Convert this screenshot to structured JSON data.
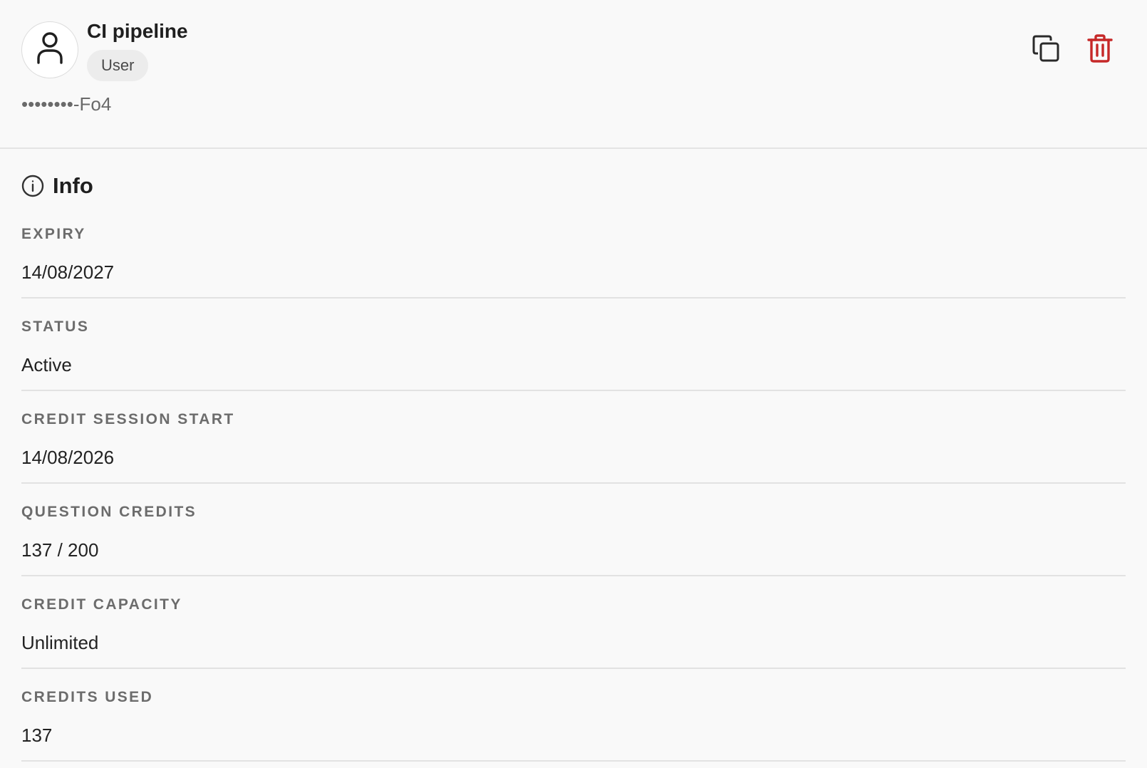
{
  "key": {
    "name": "CI pipeline",
    "role": "User",
    "masked_value": "••••••••-Fo4"
  },
  "actions": {
    "copy_icon": "copy-icon",
    "delete_icon": "trash-icon",
    "delete_color": "#c62828"
  },
  "info": {
    "title": "Info",
    "fields": [
      {
        "label": "EXPIRY",
        "value": "14/08/2027"
      },
      {
        "label": "STATUS",
        "value": "Active"
      },
      {
        "label": "CREDIT SESSION START",
        "value": "14/08/2026"
      },
      {
        "label": "QUESTION CREDITS",
        "value": "137 / 200"
      },
      {
        "label": "CREDIT CAPACITY",
        "value": "Unlimited"
      },
      {
        "label": "CREDITS USED",
        "value": "137"
      }
    ]
  }
}
